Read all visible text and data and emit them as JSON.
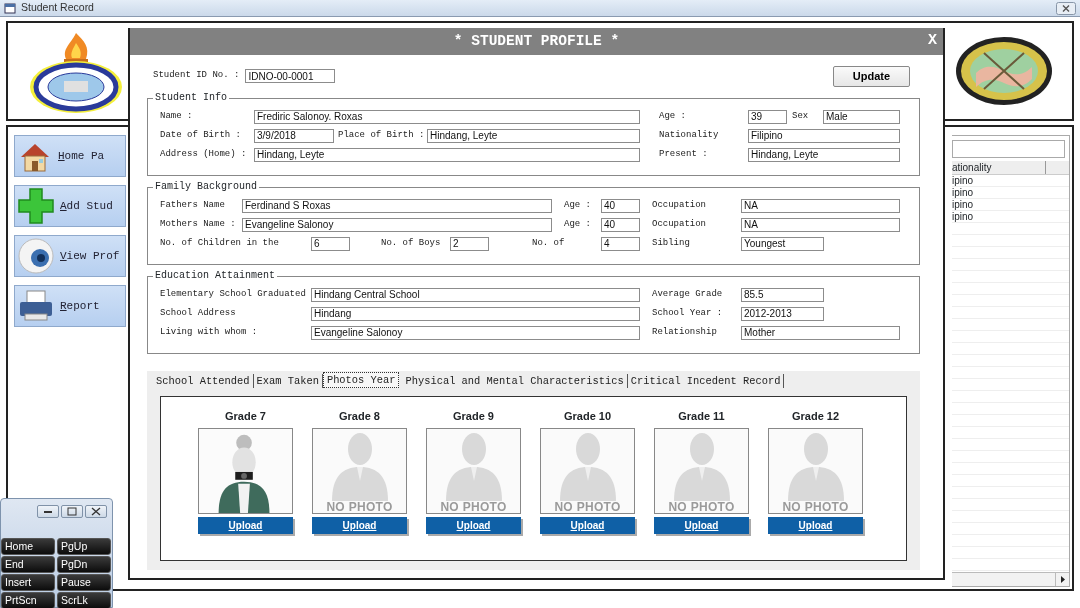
{
  "window": {
    "title": "Student Record"
  },
  "nav": [
    {
      "label": "Home Pa"
    },
    {
      "label": "Add Stud"
    },
    {
      "label": "View Prof"
    },
    {
      "label": "Report"
    }
  ],
  "grid": {
    "columns": [
      "ationality"
    ],
    "rows": [
      "ipino",
      "ipino",
      "ipino",
      "ipino"
    ]
  },
  "profile": {
    "title": "* STUDENT PROFILE *",
    "close": "X",
    "id_label": "Student ID No. :",
    "id_value": "IDNO-00-0001",
    "update": "Update",
    "sections": [
      {
        "legend": "Student Info",
        "rows": [
          [
            {
              "kind": "label",
              "text": "Name :"
            },
            {
              "kind": "field",
              "value": "Frediric Salonoy. Roxas"
            },
            {
              "kind": "gap"
            },
            {
              "kind": "gap"
            },
            {
              "kind": "label",
              "text": "Age :"
            },
            {
              "kind": "field",
              "value": "39"
            },
            {
              "kind": "label",
              "text": "Sex"
            },
            {
              "kind": "field",
              "value": "Male"
            }
          ],
          [
            {
              "kind": "label",
              "text": "Date of Birth :"
            },
            {
              "kind": "field",
              "value": "3/9/2018"
            },
            {
              "kind": "label",
              "text": "Place of Birth :"
            },
            {
              "kind": "field",
              "value": "Hindang, Leyte"
            },
            {
              "kind": "label",
              "text": "Nationality"
            },
            {
              "kind": "field",
              "value": "Filipino"
            }
          ],
          [
            {
              "kind": "label",
              "text": "Address (Home) :"
            },
            {
              "kind": "field",
              "value": "Hindang, Leyte"
            },
            {
              "kind": "gap"
            },
            {
              "kind": "gap"
            },
            {
              "kind": "label",
              "text": "Present :"
            },
            {
              "kind": "field",
              "value": "Hindang, Leyte"
            }
          ]
        ]
      },
      {
        "legend": "Family Background",
        "rows": [
          [
            {
              "kind": "label",
              "text": "Fathers Name"
            },
            {
              "kind": "field",
              "value": "Ferdinand S Roxas"
            },
            {
              "kind": "gap"
            },
            {
              "kind": "gap"
            },
            {
              "kind": "label",
              "text": "Age :"
            },
            {
              "kind": "field",
              "value": "40"
            },
            {
              "kind": "label",
              "text": "Occupation"
            },
            {
              "kind": "field",
              "value": "NA"
            }
          ],
          [
            {
              "kind": "label",
              "text": "Mothers Name :"
            },
            {
              "kind": "field",
              "value": "Evangeline Salonoy"
            },
            {
              "kind": "gap"
            },
            {
              "kind": "gap"
            },
            {
              "kind": "label",
              "text": "Age :"
            },
            {
              "kind": "field",
              "value": "40"
            },
            {
              "kind": "label",
              "text": "Occupation"
            },
            {
              "kind": "field",
              "value": "NA"
            }
          ],
          [
            {
              "kind": "label",
              "text": "No. of Children in the"
            },
            {
              "kind": "field",
              "value": "6"
            },
            {
              "kind": "label",
              "text": "No. of Boys"
            },
            {
              "kind": "field",
              "value": "2"
            },
            {
              "kind": "label",
              "text": "No. of"
            },
            {
              "kind": "field",
              "value": "4"
            },
            {
              "kind": "label",
              "text": "Sibling"
            },
            {
              "kind": "field",
              "value": "Youngest"
            }
          ]
        ]
      },
      {
        "legend": "Education Attainment",
        "rows": [
          [
            {
              "kind": "label",
              "text": "Elementary School Graduated"
            },
            {
              "kind": "field",
              "value": "Hindang Central School"
            },
            {
              "kind": "label",
              "text": "Average Grade"
            },
            {
              "kind": "field",
              "value": "85.5"
            }
          ],
          [
            {
              "kind": "label",
              "text": "School Address"
            },
            {
              "kind": "field",
              "value": "Hindang"
            },
            {
              "kind": "label",
              "text": "School Year :"
            },
            {
              "kind": "field",
              "value": "2012-2013"
            }
          ],
          [
            {
              "kind": "label",
              "text": "Living with whom :"
            },
            {
              "kind": "field",
              "value": "Evangeline Salonoy"
            },
            {
              "kind": "label",
              "text": "Relationship"
            },
            {
              "kind": "field",
              "value": "Mother"
            }
          ]
        ]
      }
    ],
    "tabs": [
      {
        "label": "School Attended",
        "selected": false
      },
      {
        "label": "Exam Taken",
        "selected": false
      },
      {
        "label": "Photos Year",
        "selected": true
      },
      {
        "label": "Physical and Mental Characteristics",
        "selected": false
      },
      {
        "label": "Critical Incedent Record",
        "selected": false
      }
    ],
    "photos": [
      {
        "label": "Grade 7",
        "photo": true,
        "button": "Upload"
      },
      {
        "label": "Grade 8",
        "photo": false,
        "placeholder": "NO PHOTO",
        "button": "Upload"
      },
      {
        "label": "Grade 9",
        "photo": false,
        "placeholder": "NO PHOTO",
        "button": "Upload"
      },
      {
        "label": "Grade 10",
        "photo": false,
        "placeholder": "NO PHOTO",
        "button": "Upload"
      },
      {
        "label": "Grade 11",
        "photo": false,
        "placeholder": "NO PHOTO",
        "button": "Upload"
      },
      {
        "label": "Grade 12",
        "photo": false,
        "placeholder": "NO PHOTO",
        "button": "Upload"
      }
    ]
  },
  "keyboard": {
    "keys": [
      "Home",
      "PgUp",
      "End",
      "PgDn",
      "Insert",
      "Pause",
      "PrtScn",
      "ScrLk"
    ]
  }
}
